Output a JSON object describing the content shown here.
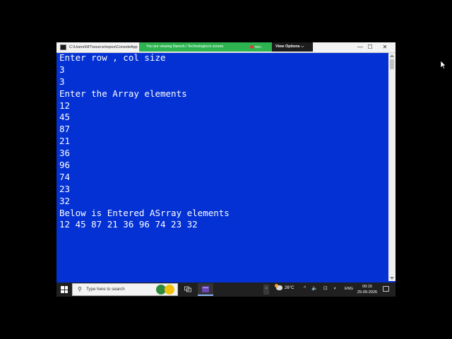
{
  "window": {
    "title": "C:\\Users\\NIT\\source\\repos\\ConsoleApp",
    "minimize_icon": "—",
    "maximize_icon": "☐",
    "close_icon": "✕"
  },
  "screen_share": {
    "banner": "You are viewing  Naresh i Technologies's screen",
    "rec": "REC",
    "view_options": "View Options ⌵"
  },
  "console": {
    "background": "#0431d4",
    "foreground": "#ffffff",
    "lines": [
      "Enter row , col size",
      "3",
      "3",
      "Enter the Array elements",
      "12",
      "45",
      "87",
      "21",
      "36",
      "96",
      "74",
      "23",
      "32",
      "Below is Entered ASrray elements",
      "12 45 87 21 36 96 74 23 32"
    ]
  },
  "taskbar": {
    "search_placeholder": "Type here to search",
    "search_icon": "⚲",
    "chevron": "^",
    "weather": "26°C",
    "tray_icons": "^ 🔈 ⊡ ◖",
    "language": "ENG",
    "time": "09:15",
    "date": "25-09-2026"
  }
}
